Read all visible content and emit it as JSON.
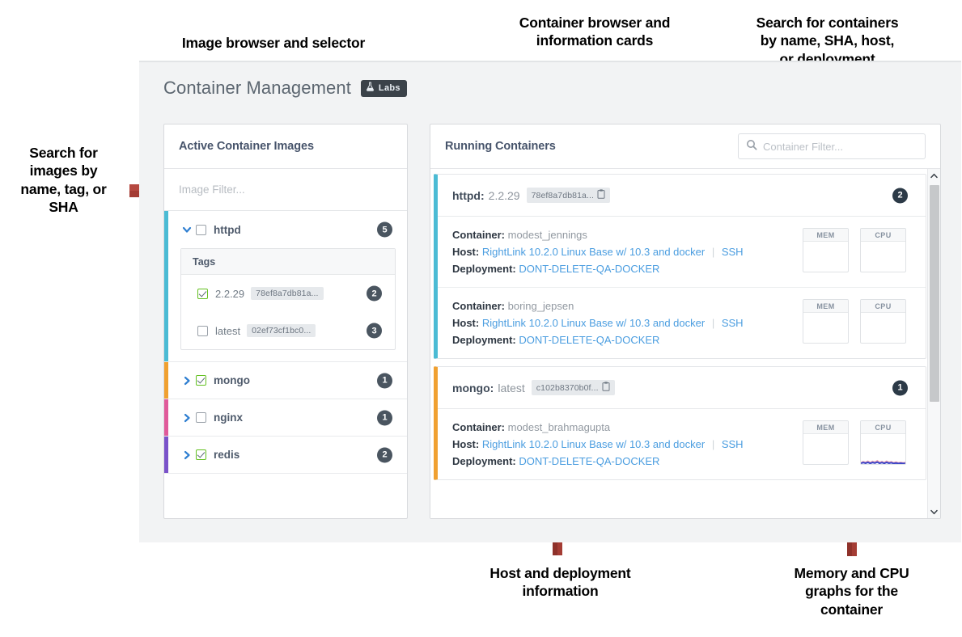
{
  "annotations": [
    {
      "id": "image-browser",
      "text": "Image browser and selector"
    },
    {
      "id": "container-browser",
      "text": "Container browser and\ninformation cards"
    },
    {
      "id": "container-search",
      "text": "Search for containers\nby name, SHA, host,\nor deployment"
    },
    {
      "id": "image-search",
      "text": "Search for\nimages by\nname, tag, or\nSHA"
    },
    {
      "id": "host-deployment",
      "text": "Host and deployment\ninformation"
    },
    {
      "id": "mem-cpu",
      "text": "Memory and CPU\ngraphs for the\ncontainer"
    }
  ],
  "colors": {
    "arrow": "#a43c34",
    "accent_link": "#4a9de0",
    "badge_dark": "#4a5560",
    "httpd_bar": "#4bbbd4",
    "mongo_bar": "#f0a030",
    "nginx_bar": "#e05a9a",
    "redis_bar": "#7a52c9",
    "check_green": "#63c020",
    "page_bg": "#f2f3f4"
  },
  "header": {
    "title": "Container Management",
    "badge_label": "Labs",
    "badge_icon": "flask-icon"
  },
  "images_panel": {
    "title": "Active Container Images",
    "filter_placeholder": "Image Filter...",
    "tags_header": "Tags",
    "groups": [
      {
        "name": "httpd",
        "count": "5",
        "checked": false,
        "expanded": true,
        "bar_color": "#4bbbd4",
        "chevron": "chevron-down-icon",
        "tags": [
          {
            "tag": "2.2.29",
            "sha": "78ef8a7db81a...",
            "count": "2",
            "checked": true
          },
          {
            "tag": "latest",
            "sha": "02ef73cf1bc0...",
            "count": "3",
            "checked": false
          }
        ]
      },
      {
        "name": "mongo",
        "count": "1",
        "checked": true,
        "expanded": false,
        "bar_color": "#f0a030",
        "chevron": "chevron-right-icon",
        "tags": []
      },
      {
        "name": "nginx",
        "count": "1",
        "checked": false,
        "expanded": false,
        "bar_color": "#e05a9a",
        "chevron": "chevron-right-icon",
        "tags": []
      },
      {
        "name": "redis",
        "count": "2",
        "checked": true,
        "expanded": false,
        "bar_color": "#7a52c9",
        "chevron": "chevron-right-icon",
        "tags": []
      }
    ]
  },
  "containers_panel": {
    "title": "Running Containers",
    "filter_placeholder": "Container Filter...",
    "filter_icon": "search-icon",
    "copy_icon": "clipboard-copy-icon",
    "labels": {
      "container": "Container:",
      "host": "Host:",
      "deployment": "Deployment:",
      "ssh": "SSH",
      "mem": "MEM",
      "cpu": "CPU"
    },
    "cards": [
      {
        "image": "httpd:",
        "tag": "2.2.29",
        "sha": "78ef8a7db81a...",
        "count": "2",
        "bar_color": "#4bbbd4",
        "containers": [
          {
            "name": "modest_jennings",
            "host": "RightLink 10.2.0 Linux Base w/ 10.3 and docker",
            "deployment": "DONT-DELETE-QA-DOCKER",
            "mem_spark": false,
            "cpu_spark": false
          },
          {
            "name": "boring_jepsen",
            "host": "RightLink 10.2.0 Linux Base w/ 10.3 and docker",
            "deployment": "DONT-DELETE-QA-DOCKER",
            "mem_spark": false,
            "cpu_spark": false
          }
        ]
      },
      {
        "image": "mongo:",
        "tag": "latest",
        "sha": "c102b8370b0f...",
        "count": "1",
        "bar_color": "#f0a030",
        "containers": [
          {
            "name": "modest_brahmagupta",
            "host": "RightLink 10.2.0 Linux Base w/ 10.3 and docker",
            "deployment": "DONT-DELETE-QA-DOCKER",
            "mem_spark": false,
            "cpu_spark": true
          }
        ]
      }
    ],
    "scrollbar": {
      "up_icon": "chevron-up-icon",
      "down_icon": "chevron-down-icon"
    }
  }
}
